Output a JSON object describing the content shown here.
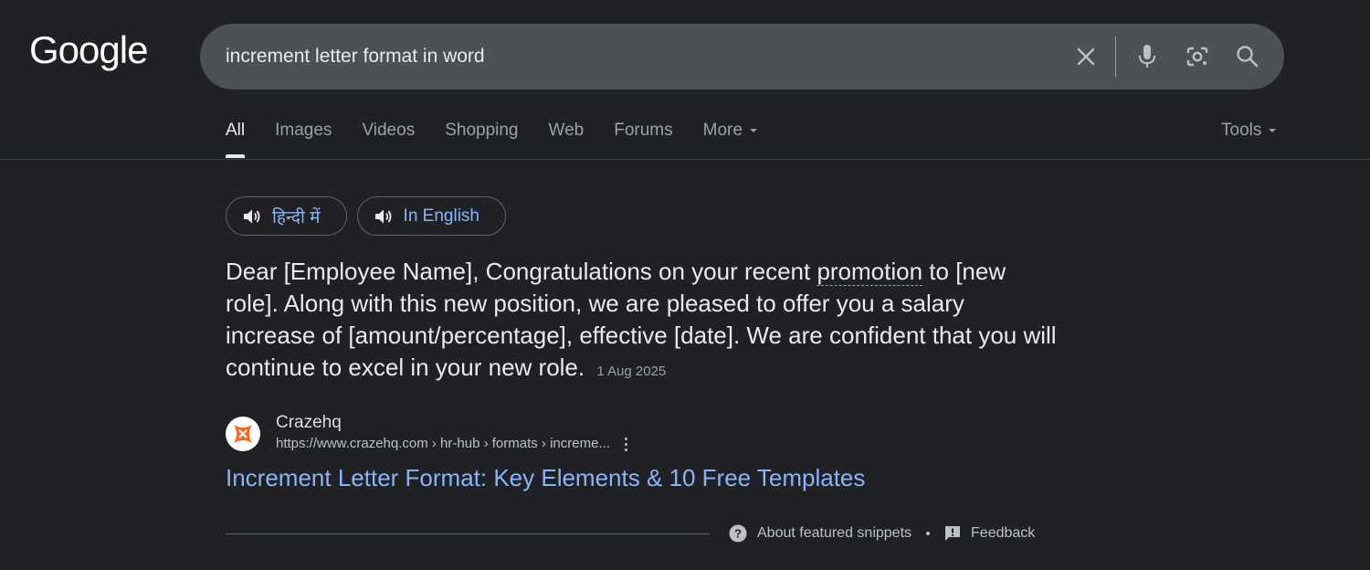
{
  "logo": {
    "text": "Google"
  },
  "search": {
    "query": "increment letter format in word",
    "icons": [
      "close-icon",
      "microphone-icon",
      "camera-lens-icon",
      "search-icon"
    ]
  },
  "tabs": [
    {
      "label": "All",
      "active": true
    },
    {
      "label": "Images"
    },
    {
      "label": "Videos"
    },
    {
      "label": "Shopping"
    },
    {
      "label": "Web"
    },
    {
      "label": "Forums"
    },
    {
      "label": "More"
    }
  ],
  "tools": {
    "label": "Tools"
  },
  "listen": {
    "hindi_label": "हिन्दी में",
    "english_label": "In English"
  },
  "snippet": {
    "text_before": "Dear [Employee Name], Congratulations on your recent ",
    "highlighted_word": "promotion",
    "text_after": " to [new role]. Along with this new position, we are pleased to offer you a salary increase of [amount/percentage], effective [date]. We are confident that you will continue to excel in your new role.",
    "date": "1 Aug 2025"
  },
  "source": {
    "name": "Crazehq",
    "url": "https://www.crazehq.com › hr-hub › formats › increme..."
  },
  "result": {
    "title": "Increment Letter Format: Key Elements & 10 Free Templates"
  },
  "footer": {
    "about_label": "About featured snippets",
    "feedback_label": "Feedback"
  },
  "colors": {
    "background": "#202124",
    "search_box": "#4d5156",
    "link": "#8ab4f8",
    "favicon_accent": "#f26b21"
  }
}
